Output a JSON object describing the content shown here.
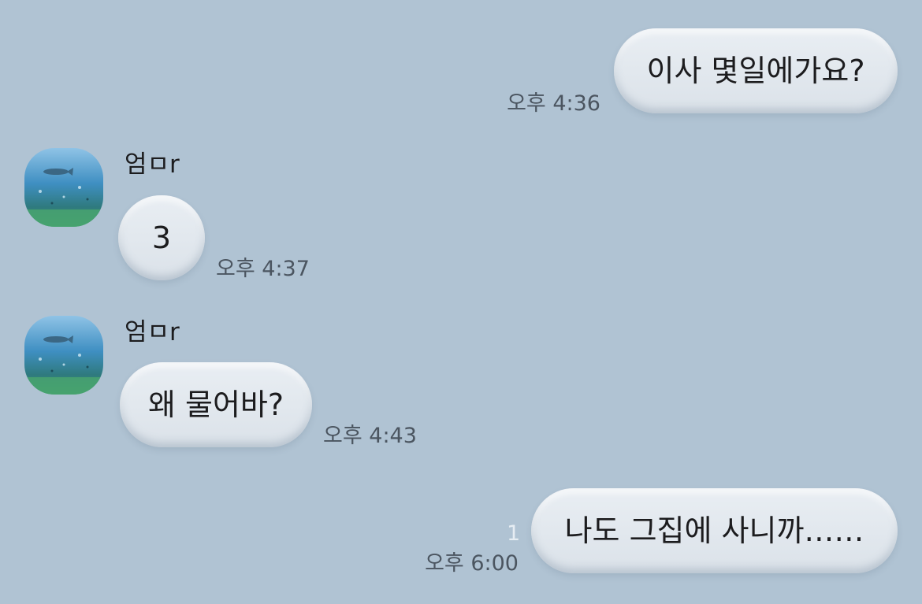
{
  "colors": {
    "background": "#b0c3d3",
    "bubble": "#dde4ea",
    "timestamp_text": "#4b5560",
    "unread_count": "#e6edf3"
  },
  "messages": [
    {
      "direction": "outgoing",
      "text": "이사 몇일에가요?",
      "time": "오후 4:36"
    },
    {
      "direction": "incoming",
      "sender": "엄ㅁr",
      "avatar_icon": "underwater-dolphin-avatar",
      "text": "3",
      "time": "오후 4:37"
    },
    {
      "direction": "incoming",
      "sender": "엄ㅁr",
      "avatar_icon": "underwater-dolphin-avatar",
      "text": "왜 물어바?",
      "time": "오후 4:43"
    },
    {
      "direction": "outgoing",
      "text": "나도 그집에 사니까……",
      "time": "오후 6:00",
      "unread_count": "1"
    }
  ]
}
